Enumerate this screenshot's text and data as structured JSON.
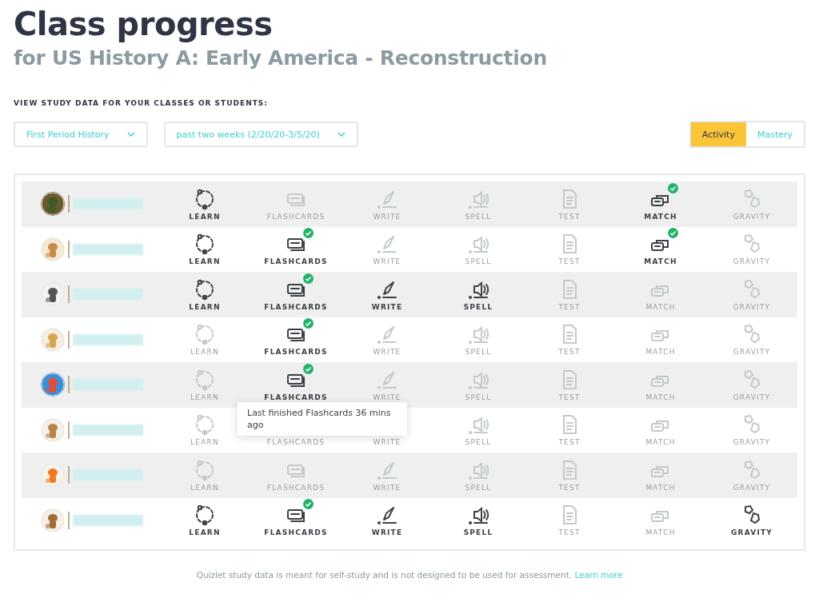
{
  "title": "Class progress",
  "subtitle": "for US History A: Early America - Reconstruction",
  "filter_label": "VIEW STUDY DATA FOR YOUR CLASSES OR STUDENTS:",
  "dropdowns": [
    {
      "value": "First Period History"
    },
    {
      "value": "past two weeks (2/20/20-3/5/20)"
    }
  ],
  "view_tabs": [
    {
      "label": "Activity",
      "selected": true
    },
    {
      "label": "Mastery",
      "selected": false
    }
  ],
  "students": [
    {
      "avatar": {
        "kind": "picture"
      },
      "modes": [
        {
          "kind": "learn",
          "label": "LEARN",
          "done": true,
          "completed": false
        },
        {
          "kind": "flashcards",
          "label": "FLASHCARDS",
          "done": false,
          "completed": false
        },
        {
          "kind": "write",
          "label": "WRITE",
          "done": false,
          "completed": false
        },
        {
          "kind": "spell",
          "label": "SPELL",
          "done": false,
          "completed": false
        },
        {
          "kind": "test",
          "label": "TEST",
          "done": false,
          "completed": false
        },
        {
          "kind": "match",
          "label": "MATCH",
          "done": true,
          "completed": true
        },
        {
          "kind": "gravity",
          "label": "GRAVITY",
          "done": false,
          "completed": false
        }
      ]
    },
    {
      "avatar": {
        "kind": "picture"
      },
      "modes": [
        {
          "kind": "learn",
          "label": "LEARN",
          "done": true,
          "completed": false
        },
        {
          "kind": "flashcards",
          "label": "FLASHCARDS",
          "done": true,
          "completed": true
        },
        {
          "kind": "write",
          "label": "WRITE",
          "done": false,
          "completed": false
        },
        {
          "kind": "spell",
          "label": "SPELL",
          "done": false,
          "completed": false
        },
        {
          "kind": "test",
          "label": "TEST",
          "done": false,
          "completed": false
        },
        {
          "kind": "match",
          "label": "MATCH",
          "done": true,
          "completed": true
        },
        {
          "kind": "gravity",
          "label": "GRAVITY",
          "done": false,
          "completed": false
        }
      ]
    },
    {
      "avatar": {
        "kind": "picture"
      },
      "modes": [
        {
          "kind": "learn",
          "label": "LEARN",
          "done": true,
          "completed": false
        },
        {
          "kind": "flashcards",
          "label": "FLASHCARDS",
          "done": true,
          "completed": true
        },
        {
          "kind": "write",
          "label": "WRITE",
          "done": true,
          "completed": false
        },
        {
          "kind": "spell",
          "label": "SPELL",
          "done": true,
          "completed": false
        },
        {
          "kind": "test",
          "label": "TEST",
          "done": false,
          "completed": false
        },
        {
          "kind": "match",
          "label": "MATCH",
          "done": false,
          "completed": false
        },
        {
          "kind": "gravity",
          "label": "GRAVITY",
          "done": false,
          "completed": false
        }
      ]
    },
    {
      "avatar": {
        "kind": "picture"
      },
      "modes": [
        {
          "kind": "learn",
          "label": "LEARN",
          "done": false,
          "completed": false
        },
        {
          "kind": "flashcards",
          "label": "FLASHCARDS",
          "done": true,
          "completed": true
        },
        {
          "kind": "write",
          "label": "WRITE",
          "done": false,
          "completed": false
        },
        {
          "kind": "spell",
          "label": "SPELL",
          "done": false,
          "completed": false
        },
        {
          "kind": "test",
          "label": "TEST",
          "done": false,
          "completed": false
        },
        {
          "kind": "match",
          "label": "MATCH",
          "done": false,
          "completed": false
        },
        {
          "kind": "gravity",
          "label": "GRAVITY",
          "done": false,
          "completed": false
        }
      ]
    },
    {
      "avatar": {
        "kind": "picture"
      },
      "modes": [
        {
          "kind": "learn",
          "label": "LEARN",
          "done": false,
          "completed": false
        },
        {
          "kind": "flashcards",
          "label": "FLASHCARDS",
          "done": true,
          "completed": true,
          "tooltip": "Last finished Flashcards 36 mins ago"
        },
        {
          "kind": "write",
          "label": "WRITE",
          "done": false,
          "completed": false
        },
        {
          "kind": "spell",
          "label": "SPELL",
          "done": false,
          "completed": false
        },
        {
          "kind": "test",
          "label": "TEST",
          "done": false,
          "completed": false
        },
        {
          "kind": "match",
          "label": "MATCH",
          "done": false,
          "completed": false
        },
        {
          "kind": "gravity",
          "label": "GRAVITY",
          "done": false,
          "completed": false
        }
      ]
    },
    {
      "avatar": {
        "kind": "picture"
      },
      "modes": [
        {
          "kind": "learn",
          "label": "LEARN",
          "done": false,
          "completed": false
        },
        {
          "label": "FLASHCARDS"
        },
        {
          "label": "WRITE"
        },
        {
          "kind": "spell",
          "label": "SPELL",
          "done": false,
          "completed": false
        },
        {
          "kind": "test",
          "label": "TEST",
          "done": false,
          "completed": false
        },
        {
          "kind": "match",
          "label": "MATCH",
          "done": false,
          "completed": false
        },
        {
          "kind": "gravity",
          "label": "GRAVITY",
          "done": false,
          "completed": false
        }
      ]
    },
    {
      "avatar": {
        "kind": "picture"
      },
      "modes": [
        {
          "kind": "learn",
          "label": "LEARN",
          "done": false,
          "completed": false
        },
        {
          "kind": "flashcards",
          "label": "FLASHCARDS",
          "done": false,
          "completed": false
        },
        {
          "kind": "write",
          "label": "WRITE",
          "done": false,
          "completed": false
        },
        {
          "kind": "spell",
          "label": "SPELL",
          "done": false,
          "completed": false
        },
        {
          "kind": "test",
          "label": "TEST",
          "done": false,
          "completed": false
        },
        {
          "kind": "match",
          "label": "MATCH",
          "done": false,
          "completed": false
        },
        {
          "kind": "gravity",
          "label": "GRAVITY",
          "done": false,
          "completed": false
        }
      ]
    },
    {
      "avatar": {
        "kind": "picture"
      },
      "modes": [
        {
          "kind": "learn",
          "label": "LEARN",
          "done": true,
          "completed": false
        },
        {
          "kind": "flashcards",
          "label": "FLASHCARDS",
          "done": true,
          "completed": true
        },
        {
          "kind": "write",
          "label": "WRITE",
          "done": true,
          "completed": false
        },
        {
          "kind": "spell",
          "label": "SPELL",
          "done": true,
          "completed": false
        },
        {
          "kind": "test",
          "label": "TEST",
          "done": false,
          "completed": false
        },
        {
          "kind": "match",
          "label": "MATCH",
          "done": false,
          "completed": false
        },
        {
          "kind": "gravity",
          "label": "GRAVITY",
          "done": true,
          "completed": false
        }
      ]
    }
  ],
  "footer": {
    "text": "Quizlet study data is meant for self-study and is not designed to be used for assessment.",
    "link": "Learn more"
  }
}
